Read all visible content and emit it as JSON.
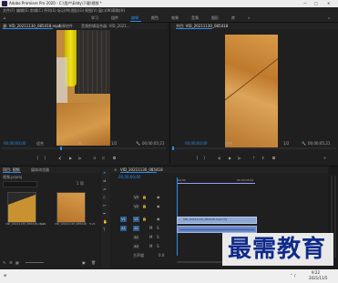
{
  "window": {
    "title": "Adobe Premiere Pro 2020 - C:\\用户\\Eddy\\下载\\视频 *"
  },
  "menu": [
    "文件(F)",
    "编辑(E)",
    "剪辑(C)",
    "序列(S)",
    "标记(M)",
    "图形(G)",
    "视图(V)",
    "窗口(W)",
    "帮助(H)"
  ],
  "workspaces": [
    "学习",
    "组件",
    "编辑",
    "颜色",
    "效果",
    "音频",
    "图形",
    "库"
  ],
  "workspaces_active": "编辑",
  "source_panel": {
    "tabs": [
      "源: VID_20211130_085418.mp4",
      "效果控件",
      "音频剪辑混合器: VID_2021..."
    ],
    "timecode_left": "00;00;00;00",
    "fit": "适合",
    "fraction": "1/2",
    "timecode_right": "00;00;05;21"
  },
  "program_panel": {
    "tab": "节目: VID_20211130_085418",
    "timecode_left": "00;00;00;00",
    "fit": "适合",
    "fraction": "1/2",
    "timecode_right": "00;00;05;21"
  },
  "project_panel": {
    "tabs": [
      "项目: 视频",
      "媒体浏览器"
    ],
    "project_name": "视频.prproj",
    "item_count": "1 项",
    "clips": [
      {
        "name": "VID_20211130_085418.mp4",
        "duration": "5;21"
      },
      {
        "name": "VID_20211130_085418",
        "duration": "5;21"
      }
    ]
  },
  "timeline": {
    "tab": "VID_20211130_085418",
    "timecode": "00;00;00;00",
    "ruler": [
      ":00;00",
      "00;00;05;00"
    ],
    "video_tracks": [
      "V3",
      "V2",
      "V1"
    ],
    "audio_tracks": [
      "A1",
      "A2",
      "A3"
    ],
    "master": "主声道",
    "master_value": "0.0",
    "clip_v1": "VID_20211130_085418.mp4 [V]",
    "clip_a1": ""
  },
  "taskbar": {
    "time": "9:22",
    "date": "2021/11/5"
  },
  "watermark": {
    "text": "最需教育"
  },
  "colors": {
    "accent": "#2d8ceb",
    "clip_video": "#8ea8d6",
    "clip_audio": "#6a88c9"
  }
}
